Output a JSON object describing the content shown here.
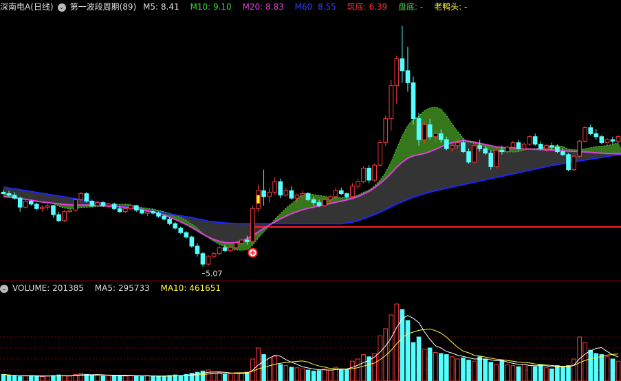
{
  "header": {
    "stock_name": "深南电A(日线)",
    "indicator_name": "第一波段周期(89)",
    "m5": {
      "label": "M5:",
      "value": "8.41",
      "color": "#e0e0e0"
    },
    "m10": {
      "label": "M10:",
      "value": "9.10",
      "color": "#3fd63f"
    },
    "m20": {
      "label": "M20:",
      "value": "8.83",
      "color": "#e040e0"
    },
    "m60": {
      "label": "M60:",
      "value": "8.55",
      "color": "#2f3fff"
    },
    "zhudi": {
      "label": "筑底:",
      "value": "6.39",
      "color": "#ff3030"
    },
    "pandi": {
      "label": "盘底:",
      "value": "-",
      "color": "#3fd63f"
    },
    "laoyatou": {
      "label": "老鸭头:",
      "value": "-",
      "color": "#ffff40"
    }
  },
  "volume_header": {
    "volume": {
      "label": "VOLUME:",
      "value": "201385",
      "color": "#e0e0e0"
    },
    "ma5": {
      "label": "MA5:",
      "value": "295733",
      "color": "#e0e0e0"
    },
    "ma10": {
      "label": "MA10:",
      "value": "461651",
      "color": "#ffff40"
    }
  },
  "annotations": {
    "low_label": "5.07"
  },
  "chart_data": [
    {
      "type": "candlestick",
      "ylim": [
        4.6,
        13.5
      ],
      "low_marker": 5.07,
      "support_line": {
        "value": 6.39,
        "color": "#ff2020"
      },
      "candles": [
        [
          7.55,
          7.62,
          7.48,
          7.5
        ],
        [
          7.5,
          7.6,
          7.4,
          7.45
        ],
        [
          7.45,
          7.55,
          7.3,
          7.35
        ],
        [
          7.35,
          7.4,
          6.9,
          7.05
        ],
        [
          7.05,
          7.3,
          7.0,
          7.25
        ],
        [
          7.25,
          7.3,
          7.1,
          7.15
        ],
        [
          7.15,
          7.2,
          6.95,
          7.0
        ],
        [
          7.0,
          7.1,
          6.9,
          7.05
        ],
        [
          7.05,
          7.15,
          6.95,
          7.1
        ],
        [
          7.1,
          7.12,
          6.7,
          6.8
        ],
        [
          6.8,
          6.9,
          6.55,
          6.6
        ],
        [
          6.6,
          6.95,
          6.55,
          6.9
        ],
        [
          6.9,
          7.0,
          6.85,
          6.95
        ],
        [
          6.95,
          7.35,
          6.9,
          7.3
        ],
        [
          7.3,
          7.55,
          7.25,
          7.5
        ],
        [
          7.5,
          7.55,
          7.2,
          7.25
        ],
        [
          7.25,
          7.3,
          7.05,
          7.1
        ],
        [
          7.1,
          7.25,
          7.05,
          7.2
        ],
        [
          7.2,
          7.25,
          7.05,
          7.1
        ],
        [
          7.1,
          7.2,
          7.0,
          7.15
        ],
        [
          7.15,
          7.2,
          6.95,
          7.0
        ],
        [
          7.0,
          7.1,
          6.85,
          6.9
        ],
        [
          6.9,
          7.05,
          6.85,
          7.0
        ],
        [
          7.0,
          7.15,
          6.95,
          7.1
        ],
        [
          7.1,
          7.12,
          6.9,
          6.95
        ],
        [
          6.95,
          7.0,
          6.8,
          6.85
        ],
        [
          6.85,
          6.95,
          6.75,
          6.9
        ],
        [
          6.9,
          7.0,
          6.8,
          6.85
        ],
        [
          6.85,
          6.9,
          6.7,
          6.75
        ],
        [
          6.75,
          6.8,
          6.6,
          6.65
        ],
        [
          6.65,
          6.7,
          6.45,
          6.5
        ],
        [
          6.5,
          6.55,
          6.3,
          6.35
        ],
        [
          6.35,
          6.4,
          6.15,
          6.2
        ],
        [
          6.2,
          6.25,
          6.0,
          6.05
        ],
        [
          6.05,
          6.1,
          5.7,
          5.75
        ],
        [
          5.75,
          5.85,
          5.4,
          5.5
        ],
        [
          5.5,
          5.55,
          5.07,
          5.15
        ],
        [
          5.15,
          5.45,
          5.1,
          5.4
        ],
        [
          5.4,
          5.55,
          5.35,
          5.5
        ],
        [
          5.5,
          5.75,
          5.45,
          5.7
        ],
        [
          5.7,
          5.8,
          5.55,
          5.6
        ],
        [
          5.6,
          5.75,
          5.55,
          5.7
        ],
        [
          5.7,
          5.9,
          5.65,
          5.85
        ],
        [
          5.85,
          6.0,
          5.8,
          5.95
        ],
        [
          5.95,
          6.1,
          5.8,
          5.9
        ],
        [
          5.9,
          7.1,
          5.85,
          7.0
        ],
        [
          7.0,
          7.8,
          6.9,
          7.6
        ],
        [
          7.6,
          8.3,
          7.1,
          7.4
        ],
        [
          7.4,
          7.7,
          7.2,
          7.55
        ],
        [
          7.55,
          8.05,
          7.45,
          7.9
        ],
        [
          7.9,
          8.0,
          7.35,
          7.45
        ],
        [
          7.45,
          7.7,
          7.4,
          7.6
        ],
        [
          7.6,
          7.75,
          7.3,
          7.35
        ],
        [
          7.35,
          7.5,
          7.2,
          7.45
        ],
        [
          7.45,
          7.6,
          7.35,
          7.5
        ],
        [
          7.5,
          7.55,
          7.25,
          7.3
        ],
        [
          7.3,
          7.4,
          7.1,
          7.2
        ],
        [
          7.2,
          7.3,
          7.05,
          7.1
        ],
        [
          7.1,
          7.35,
          7.05,
          7.3
        ],
        [
          7.3,
          7.45,
          7.2,
          7.4
        ],
        [
          7.4,
          7.7,
          7.3,
          7.6
        ],
        [
          7.6,
          7.7,
          7.45,
          7.5
        ],
        [
          7.5,
          7.55,
          7.3,
          7.4
        ],
        [
          7.4,
          7.85,
          7.35,
          7.75
        ],
        [
          7.75,
          8.0,
          7.65,
          7.9
        ],
        [
          7.9,
          8.4,
          7.85,
          8.35
        ],
        [
          8.35,
          8.45,
          7.85,
          7.95
        ],
        [
          7.95,
          8.5,
          7.9,
          8.45
        ],
        [
          8.45,
          9.3,
          8.4,
          9.2
        ],
        [
          9.2,
          10.1,
          9.1,
          10.0
        ],
        [
          10.0,
          11.3,
          9.6,
          11.1
        ],
        [
          11.1,
          12.1,
          10.5,
          12.0
        ],
        [
          12.0,
          13.1,
          11.2,
          11.6
        ],
        [
          11.6,
          12.4,
          10.9,
          11.2
        ],
        [
          11.2,
          11.4,
          9.8,
          10.0
        ],
        [
          10.0,
          10.2,
          9.1,
          9.3
        ],
        [
          9.3,
          9.9,
          9.15,
          9.8
        ],
        [
          9.8,
          10.0,
          9.3,
          9.4
        ],
        [
          9.4,
          9.6,
          9.2,
          9.5
        ],
        [
          9.5,
          9.65,
          9.2,
          9.3
        ],
        [
          9.3,
          9.4,
          8.95,
          9.0
        ],
        [
          9.0,
          9.2,
          8.9,
          9.1
        ],
        [
          9.1,
          9.3,
          9.0,
          9.2
        ],
        [
          9.2,
          9.3,
          8.85,
          8.9
        ],
        [
          8.9,
          9.0,
          8.5,
          8.55
        ],
        [
          8.55,
          9.2,
          8.5,
          9.1
        ],
        [
          9.1,
          9.3,
          8.9,
          9.0
        ],
        [
          9.0,
          9.1,
          8.8,
          8.85
        ],
        [
          8.85,
          8.95,
          8.3,
          8.4
        ],
        [
          8.4,
          9.0,
          8.35,
          8.95
        ],
        [
          8.95,
          9.1,
          8.8,
          8.9
        ],
        [
          8.9,
          9.1,
          8.85,
          9.05
        ],
        [
          9.05,
          9.25,
          9.0,
          9.2
        ],
        [
          9.2,
          9.3,
          8.95,
          9.0
        ],
        [
          9.0,
          9.2,
          8.95,
          9.15
        ],
        [
          9.15,
          9.45,
          9.1,
          9.4
        ],
        [
          9.4,
          9.5,
          9.1,
          9.15
        ],
        [
          9.15,
          9.25,
          8.95,
          9.0
        ],
        [
          9.0,
          9.15,
          8.9,
          9.1
        ],
        [
          9.1,
          9.2,
          8.95,
          9.05
        ],
        [
          9.05,
          9.15,
          8.85,
          8.9
        ],
        [
          8.9,
          9.0,
          8.75,
          8.8
        ],
        [
          8.8,
          8.85,
          8.25,
          8.3
        ],
        [
          8.3,
          8.8,
          8.25,
          8.75
        ],
        [
          8.75,
          9.3,
          8.7,
          9.25
        ],
        [
          9.25,
          9.75,
          9.2,
          9.7
        ],
        [
          9.7,
          9.8,
          9.45,
          9.5
        ],
        [
          9.5,
          9.65,
          9.3,
          9.4
        ],
        [
          9.4,
          9.45,
          9.15,
          9.2
        ],
        [
          9.2,
          9.35,
          9.1,
          9.3
        ],
        [
          9.3,
          9.4,
          9.15,
          9.25
        ],
        [
          9.25,
          9.45,
          9.2,
          9.4
        ]
      ],
      "series": [
        {
          "name": "M60",
          "color": "#2222ff",
          "values": [
            7.72,
            7.69,
            7.66,
            7.63,
            7.6,
            7.57,
            7.54,
            7.51,
            7.48,
            7.45,
            7.42,
            7.39,
            7.36,
            7.33,
            7.3,
            7.27,
            7.24,
            7.21,
            7.18,
            7.15,
            7.12,
            7.09,
            7.06,
            7.03,
            7.0,
            6.97,
            6.94,
            6.91,
            6.88,
            6.85,
            6.82,
            6.79,
            6.76,
            6.73,
            6.7,
            6.66,
            6.62,
            6.58,
            6.56,
            6.54,
            6.52,
            6.51,
            6.5,
            6.5,
            6.5,
            6.5,
            6.5,
            6.5,
            6.5,
            6.5,
            6.5,
            6.5,
            6.5,
            6.5,
            6.5,
            6.5,
            6.5,
            6.5,
            6.5,
            6.5,
            6.5,
            6.5,
            6.52,
            6.55,
            6.6,
            6.66,
            6.73,
            6.8,
            6.88,
            6.97,
            7.06,
            7.15,
            7.23,
            7.31,
            7.38,
            7.44,
            7.5,
            7.55,
            7.6,
            7.64,
            7.68,
            7.72,
            7.76,
            7.8,
            7.84,
            7.88,
            7.92,
            7.96,
            8.0,
            8.04,
            8.08,
            8.12,
            8.16,
            8.2,
            8.24,
            8.28,
            8.32,
            8.36,
            8.4,
            8.44,
            8.47,
            8.5,
            8.53,
            8.56,
            8.59,
            8.62,
            8.65,
            8.68,
            8.71,
            8.74,
            8.77,
            8.8,
            8.83
          ]
        },
        {
          "name": "M20",
          "color": "#e040e0",
          "values": [
            7.4,
            7.38,
            7.36,
            7.33,
            7.31,
            7.28,
            7.25,
            7.22,
            7.2,
            7.18,
            7.16,
            7.14,
            7.13,
            7.12,
            7.12,
            7.12,
            7.11,
            7.1,
            7.09,
            7.08,
            7.07,
            7.06,
            7.04,
            7.02,
            7.0,
            6.97,
            6.93,
            6.89,
            6.84,
            6.78,
            6.71,
            6.64,
            6.56,
            6.47,
            6.37,
            6.26,
            6.15,
            6.05,
            5.97,
            5.91,
            5.87,
            5.86,
            5.87,
            5.92,
            6.0,
            6.1,
            6.22,
            6.34,
            6.45,
            6.56,
            6.66,
            6.75,
            6.83,
            6.9,
            6.96,
            7.01,
            7.05,
            7.09,
            7.13,
            7.17,
            7.21,
            7.25,
            7.29,
            7.34,
            7.4,
            7.48,
            7.58,
            7.7,
            7.84,
            8.0,
            8.18,
            8.38,
            8.55,
            8.68,
            8.76,
            8.8,
            8.84,
            8.9,
            8.98,
            9.06,
            9.14,
            9.2,
            9.24,
            9.26,
            9.25,
            9.22,
            9.18,
            9.14,
            9.1,
            9.06,
            9.04,
            9.03,
            9.02,
            9.01,
            9.0,
            8.99,
            8.98,
            8.97,
            8.96,
            8.95,
            8.94,
            8.93,
            8.92,
            8.91,
            8.9,
            8.89,
            8.88,
            8.86,
            8.85,
            8.84,
            8.84,
            8.83,
            8.83
          ]
        }
      ],
      "band": {
        "name": "M10",
        "fill": "#3a7d1c",
        "lower_fill": "#3a3a3a"
      }
    },
    {
      "type": "bar",
      "series_name": "VOLUME",
      "values": [
        12,
        10,
        9,
        8,
        9,
        10,
        9,
        8,
        9,
        10,
        11,
        10,
        9,
        12,
        14,
        12,
        10,
        11,
        9,
        10,
        9,
        10,
        9,
        10,
        9,
        8,
        10,
        9,
        8,
        9,
        10,
        11,
        10,
        12,
        14,
        16,
        18,
        20,
        14,
        15,
        12,
        13,
        15,
        14,
        16,
        40,
        60,
        48,
        42,
        45,
        30,
        28,
        25,
        24,
        22,
        20,
        18,
        19,
        22,
        20,
        25,
        22,
        21,
        36,
        40,
        48,
        44,
        50,
        82,
        95,
        120,
        140,
        130,
        110,
        70,
        80,
        58,
        60,
        52,
        50,
        48,
        44,
        40,
        42,
        38,
        36,
        44,
        40,
        34,
        30,
        38,
        30,
        28,
        26,
        30,
        28,
        26,
        30,
        24,
        22,
        28,
        26,
        28,
        40,
        80,
        70,
        56,
        50,
        48,
        44,
        40,
        36
      ],
      "ma_series": [
        {
          "name": "MA5",
          "color": "#ffffff"
        },
        {
          "name": "MA10",
          "color": "#ffff40"
        }
      ],
      "grid": true
    }
  ]
}
